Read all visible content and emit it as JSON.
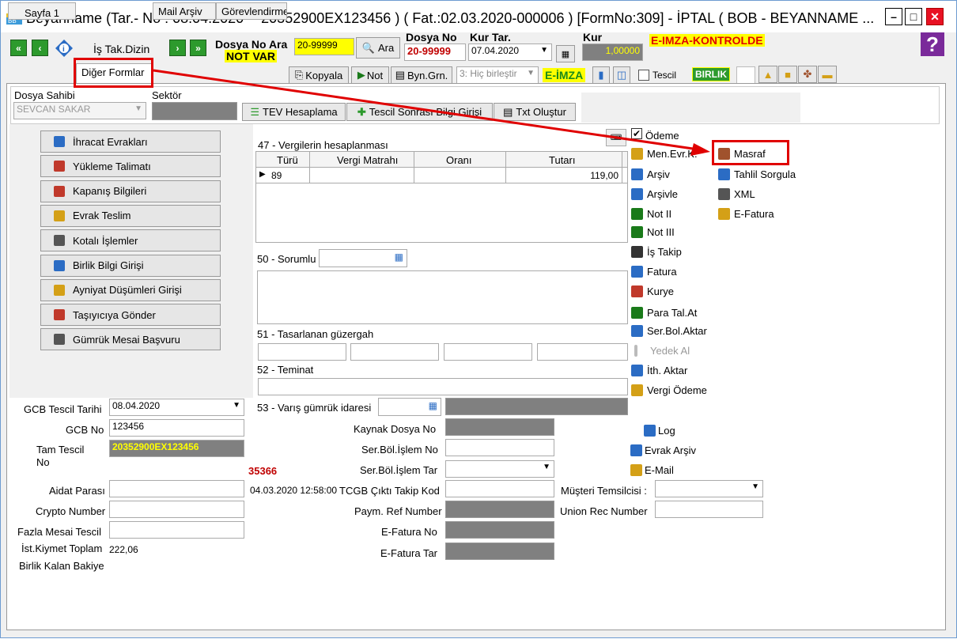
{
  "window": {
    "title": "Beyanname (Tar.- No : 08.04.2020 -- 20352900EX123456 ) ( Fat.:02.03.2020-000006 )  [FormNo:309] - İPTAL ( BOB - BEYANNAME ..."
  },
  "toolbar": {
    "is_tak_dizin": "İş Tak.Dizin",
    "dosya_no_ara_label": "Dosya No Ara",
    "dosya_no_ara_value": "20-99999",
    "not_var": "NOT VAR",
    "ara_button": "Ara",
    "dosya_no_label": "Dosya No",
    "dosya_no_value": "20-99999",
    "kur_tar_label": "Kur Tar.",
    "kur_tar_value": "07.04.2020",
    "kur_label": "Kur",
    "kur_value": "1,00000",
    "e_imza_kontrolde": "E-IMZA-KONTROLDE",
    "help": "?"
  },
  "tabs": [
    "Sayfa 1",
    "Diğer Formlar",
    "Mail Arşiv",
    "Görevlendirme",
    "Kopyala",
    "Not",
    "Byn.Grn.",
    "3: Hiç birleştir",
    "E-İMZA",
    "Tescil",
    "BIRLIK"
  ],
  "top": {
    "dosya_sahibi_label": "Dosya Sahibi",
    "dosya_sahibi_value": "SEVCAN SAKAR",
    "sektor_label": "Sektör",
    "tev_button": "TEV Hesaplama",
    "tescil_sonrasi_button": "Tescil Sonrası Bilgi Girişi",
    "txt_button": "Txt Oluştur"
  },
  "left_buttons": [
    "İhracat Evrakları",
    "Yükleme Talimatı",
    "Kapanış Bilgileri",
    "Evrak Teslim",
    "Kotalı İşlemler",
    "Birlik Bilgi Girişi",
    "Ayniyat Düşümleri Girişi",
    "Taşıyıcıya Gönder",
    "Gümrük Mesai Başvuru"
  ],
  "vergi": {
    "title": "47 - Vergilerin hesaplanması",
    "headers": [
      "Türü",
      "Vergi Matrahı",
      "Oranı",
      "Tutarı"
    ],
    "row": {
      "turu": "89",
      "matrah": "",
      "oran": "",
      "tutar": "119,00"
    }
  },
  "labels": {
    "sorumlu": "50 - Sorumlu",
    "guzergah": "51 - Tasarlanan güzergah",
    "teminat": "52 - Teminat",
    "varis": "53 - Varış gümrük idaresi"
  },
  "right_links": [
    "Ödeme",
    "Men.Evr.K.",
    "Arşiv",
    "Arşivle",
    "Not II",
    "Not III",
    "İş Takip",
    "Fatura",
    "Kurye",
    "Para Tal.At",
    "Ser.Bol.Aktar",
    "Yedek Al",
    "İth. Aktar",
    "Vergi Ödeme"
  ],
  "right_links2": [
    "Masraf",
    "Tahlil Sorgula",
    "XML",
    "E-Fatura"
  ],
  "bottom_links": [
    "Log",
    "Evrak Arşiv",
    "E-Mail"
  ],
  "fields": {
    "gcb_tescil_tarihi_label": "GCB Tescil Tarihi",
    "gcb_tescil_tarihi": "08.04.2020",
    "gcb_no_label": "GCB No",
    "gcb_no": "123456",
    "tam_tescil_label1": "Tam Tescil",
    "tam_tescil_label2": "No",
    "tam_tescil": "20352900EX123456",
    "number_red": "35366",
    "aidat_label": "Aidat Parası",
    "crypto_label": "Crypto Number",
    "fazla_label": "Fazla Mesai Tescil",
    "ist_label": "İst.Kiymet Toplam",
    "ist_value": "222,06",
    "birlik_label": "Birlik Kalan Bakiye",
    "kaynak_label": "Kaynak Dosya No",
    "serbol_no_label": "Ser.Böl.İşlem No",
    "serbol_tar_label": "Ser.Böl.İşlem Tar",
    "date_time": "04.03.2020 12:58:00",
    "tcgb_label": "TCGB Çıktı Takip Kod",
    "paym_label": "Paym. Ref Number",
    "efatura_no_label": "E-Fatura No",
    "efatura_tar_label": "E-Fatura Tar",
    "musteri_label": "Müşteri Temsilcisi :",
    "union_label": "Union Rec Number"
  },
  "colors": {
    "highlight_red": "#e00000",
    "green": "#2d9a2d",
    "gray_field": "#808080",
    "yellow": "#ffff00"
  }
}
